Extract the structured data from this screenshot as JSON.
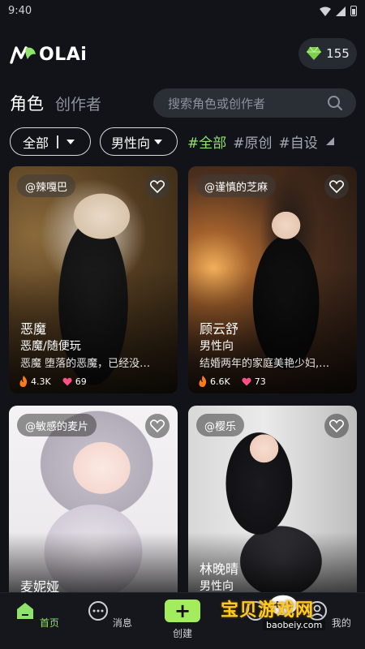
{
  "status": {
    "time": "9:40"
  },
  "app": {
    "logo_text": "OLAi",
    "coins": "155"
  },
  "tabs": [
    {
      "label": "角色"
    },
    {
      "label": "创作者"
    }
  ],
  "search": {
    "placeholder": "搜索角色或创作者"
  },
  "filters": {
    "dropdown1": "全部",
    "dropdown2": "男性向",
    "tags": [
      "#全部",
      "#原创",
      "#自设"
    ]
  },
  "cards": [
    {
      "author": "@辣嘎巴",
      "name": "恶魔",
      "tag": "恶魔/随便玩",
      "desc": "恶魔 堕落的恶魔，已经没…",
      "heat": "4.3K",
      "likes": "69"
    },
    {
      "author": "@谨慎的芝麻",
      "name": "顾云舒",
      "tag": "男性向",
      "desc": "结婚两年的家庭美艳少妇,…",
      "heat": "6.6K",
      "likes": "73"
    },
    {
      "author": "@敏感的麦片",
      "name": "麦妮娅",
      "tag": "",
      "desc": "",
      "heat": "",
      "likes": ""
    },
    {
      "author": "@樱乐",
      "name": "林晚晴",
      "tag": "男性向",
      "desc": "",
      "heat": "",
      "likes": ""
    }
  ],
  "nav": [
    {
      "label": "首页",
      "icon": "home-icon"
    },
    {
      "label": "消息",
      "icon": "message-icon"
    },
    {
      "label": "创建",
      "icon": "plus-icon"
    },
    {
      "label": "",
      "icon": "discover-icon"
    },
    {
      "label": "我的",
      "icon": "profile-icon"
    }
  ],
  "watermark": {
    "text": "宝贝游戏网",
    "url": "baobeiy.com"
  },
  "colors": {
    "accent": "#a3ec5b",
    "background": "#111318",
    "tag_active": "#8fe36a"
  }
}
